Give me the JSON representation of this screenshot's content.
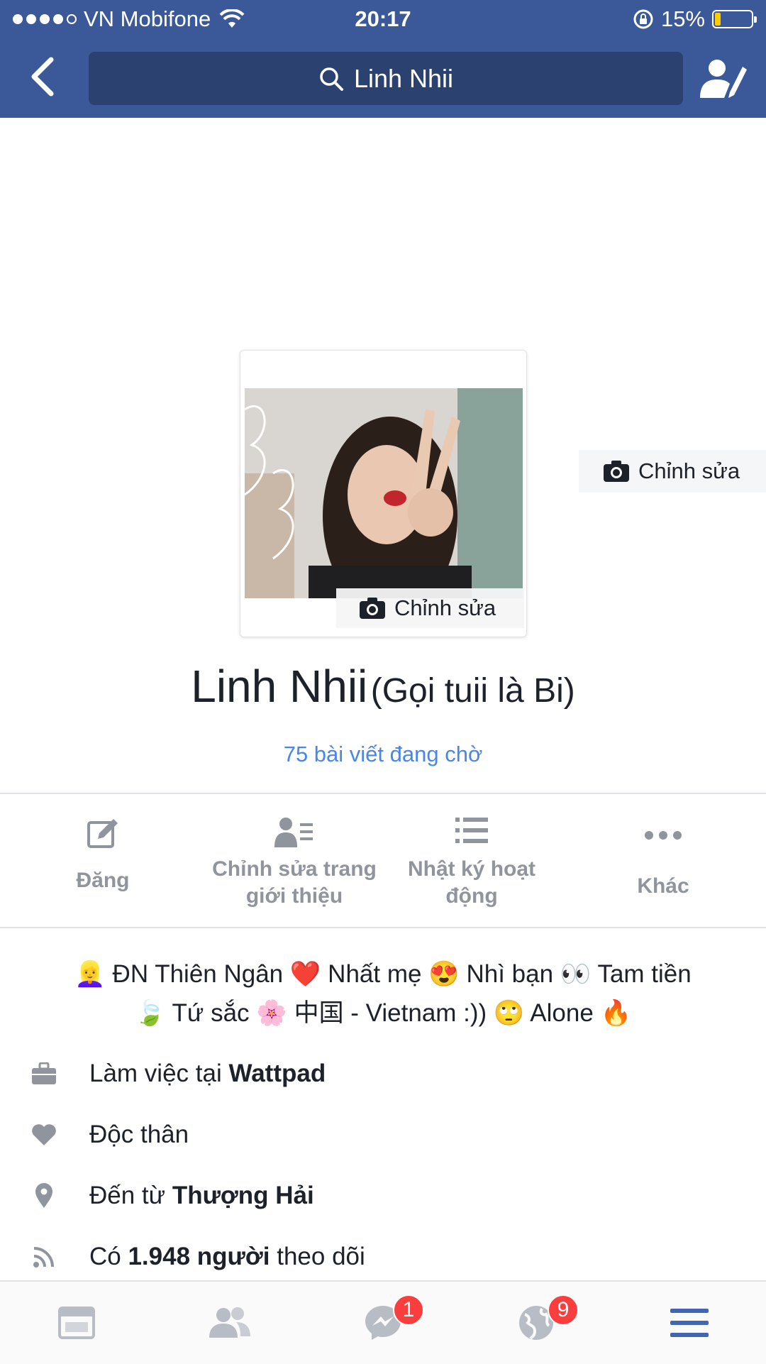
{
  "status_bar": {
    "carrier": "VN Mobifone",
    "time": "20:17",
    "battery": "15%",
    "battery_level": 0.15
  },
  "header": {
    "search_query": "Linh Nhii"
  },
  "profile": {
    "photo_edit_label": "Chỉnh sửa",
    "cover_edit_label": "Chỉnh sửa",
    "name": "Linh Nhii",
    "nickname": "(Gọi tuii là Bi)",
    "pending_posts": "75 bài viết đang chờ"
  },
  "actions": [
    {
      "label": "Đăng",
      "icon": "compose-icon"
    },
    {
      "label": "Chỉnh sửa trang giới thiệu",
      "icon": "edit-about-icon"
    },
    {
      "label": "Nhật ký hoạt động",
      "icon": "activity-log-icon"
    },
    {
      "label": "Khác",
      "icon": "more-icon"
    }
  ],
  "bio": {
    "line1": "👱‍♀️ ĐN Thiên Ngân ❤️ Nhất mẹ 😍 Nhì bạn 👀 Tam tiền",
    "line2": "🍃 Tứ sắc 🌸 中国 - Vietnam :)) 🙄 Alone 🔥"
  },
  "details": {
    "work": {
      "prefix": "Làm việc tại ",
      "value": "Wattpad",
      "icon": "briefcase-icon"
    },
    "relationship": {
      "text": "Độc thân",
      "icon": "heart-icon"
    },
    "hometown": {
      "prefix": "Đến từ ",
      "value": "Thượng Hải",
      "icon": "location-pin-icon"
    },
    "followers": {
      "prefix": "Có ",
      "value": "1.948 người",
      "suffix": " theo dõi",
      "icon": "rss-feed-icon"
    }
  },
  "tabbar": {
    "messenger_badge": "1",
    "notifications_badge": "9",
    "active_color": "#4267b2",
    "inactive_color": "#b8bcc4"
  }
}
